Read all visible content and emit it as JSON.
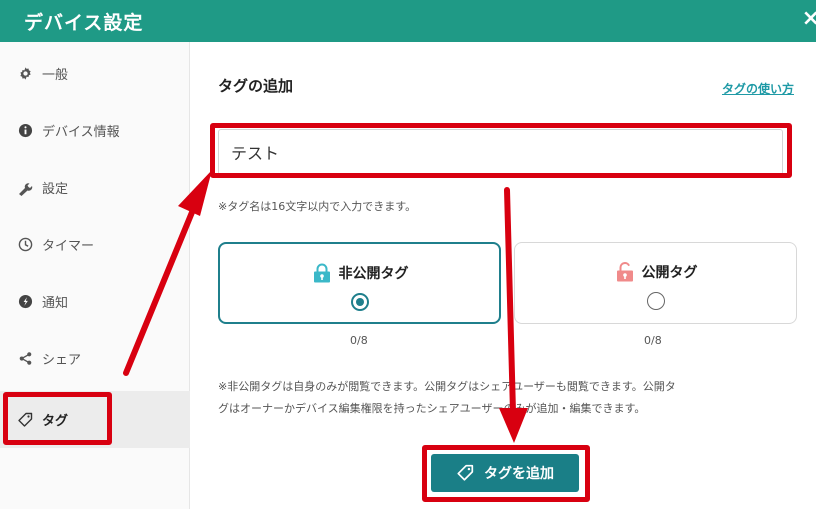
{
  "header": {
    "title": "デバイス設定",
    "close_label": "×"
  },
  "sidebar": {
    "items": [
      {
        "label": "一般",
        "icon": "gear-icon"
      },
      {
        "label": "デバイス情報",
        "icon": "info-icon"
      },
      {
        "label": "設定",
        "icon": "wrench-icon"
      },
      {
        "label": "タイマー",
        "icon": "clock-icon"
      },
      {
        "label": "通知",
        "icon": "bell-icon"
      },
      {
        "label": "シェア",
        "icon": "share-icon"
      },
      {
        "label": "タグ",
        "icon": "tag-icon",
        "active": true
      }
    ]
  },
  "main": {
    "title": "タグの追加",
    "help_link": "タグの使い方",
    "input_value": "テスト",
    "hint": "※タグ名は16文字以内で入力できます。",
    "options": [
      {
        "label": "非公開タグ",
        "count": "0/8",
        "selected": true,
        "icon": "lock-closed-icon"
      },
      {
        "label": "公開タグ",
        "count": "0/8",
        "selected": false,
        "icon": "lock-open-icon"
      }
    ],
    "note_line1": "※非公開タグは自身のみが閲覧できます。公開タグはシェアユーザーも閲覧できます。公開タ",
    "note_line2": "グはオーナーかデバイス編集権限を持ったシェアユーザーのみが追加・編集できます。",
    "add_button": "タグを追加"
  },
  "colors": {
    "header": "#1f9a86",
    "accent": "#1f7f8c",
    "annotation": "#d80010",
    "public_lock": "#f08a8a",
    "private_lock": "#3bb8c8"
  }
}
